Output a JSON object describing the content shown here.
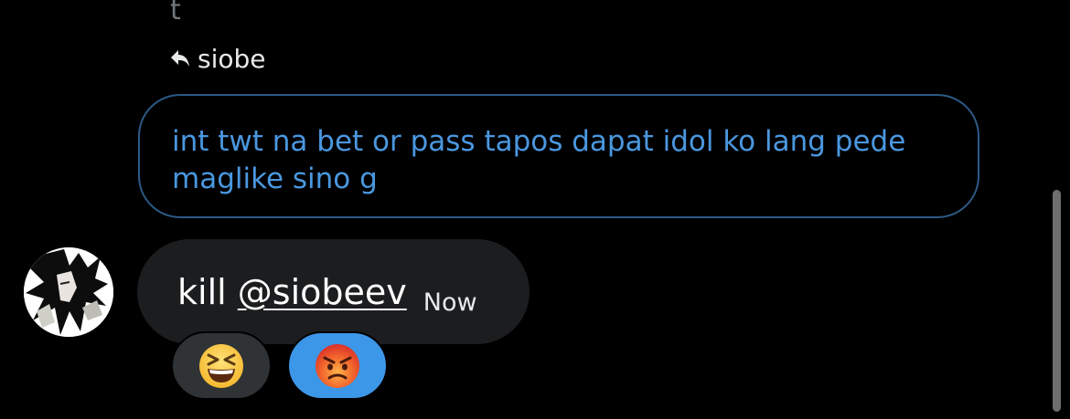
{
  "thread": {
    "top_fragment": "t"
  },
  "reply": {
    "icon": "reply-arrow-icon",
    "name": "siobe"
  },
  "quoted_message": {
    "text": "int twt na bet or pass tapos dapat idol ko lang pede maglike sino g"
  },
  "message": {
    "avatar_icon": "anime-character-avatar",
    "prefix": "kill ",
    "mention": "@siobeev",
    "time": "Now"
  },
  "reactions": [
    {
      "emoji": "😆",
      "icon": "grinning-squinting-face-icon",
      "selected": false
    },
    {
      "emoji": "😡",
      "icon": "angry-face-icon",
      "selected": true
    }
  ],
  "colors": {
    "background": "#000000",
    "quoted_text": "#4a97df",
    "quoted_border": "#2c5a86",
    "bubble": "#1c1d1f",
    "selected_reaction": "#3d97e8",
    "reaction": "#2f3336"
  }
}
